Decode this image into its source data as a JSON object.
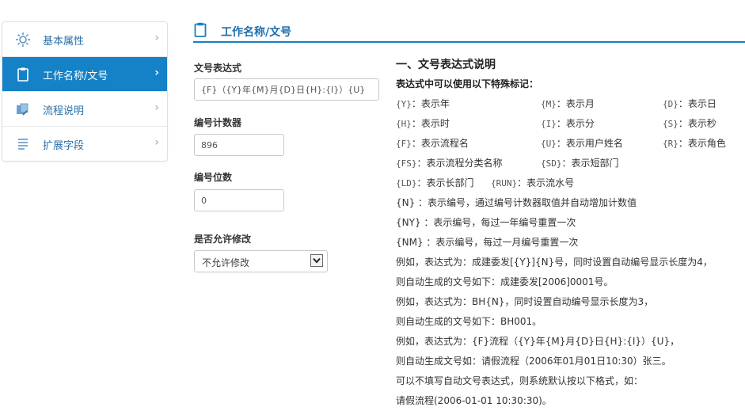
{
  "sidebar": {
    "items": [
      {
        "label": "基本属性",
        "icon": "gear-icon",
        "active": false
      },
      {
        "label": "工作名称/文号",
        "icon": "clipboard-icon",
        "active": true
      },
      {
        "label": "流程说明",
        "icon": "flow-icon",
        "active": false
      },
      {
        "label": "扩展字段",
        "icon": "list-icon",
        "active": false
      }
    ]
  },
  "header": {
    "title": "工作名称/文号",
    "icon": "clipboard-icon",
    "accent": "#1581c6"
  },
  "form": {
    "expr_label": "文号表达式",
    "expr_value": "{F}（{Y}年{M}月{D}日{H}:{I}）{U}",
    "counter_label": "编号计数器",
    "counter_value": "896",
    "digits_label": "编号位数",
    "digits_value": "0",
    "editable_label": "是否允许修改",
    "editable_value": "不允许修改"
  },
  "help": {
    "title": "一、文号表达式说明",
    "subtitle": "表达式中可以使用以下特殊标记：",
    "tokens": [
      {
        "code": "{Y}",
        "desc": "：表示年"
      },
      {
        "code": "{M}",
        "desc": "：表示月"
      },
      {
        "code": "{D}",
        "desc": "：表示日"
      },
      {
        "code": "{H}",
        "desc": "：表示时"
      },
      {
        "code": "{I}",
        "desc": "：表示分"
      },
      {
        "code": "{S}",
        "desc": "：表示秒"
      },
      {
        "code": "{F}",
        "desc": "：表示流程名"
      },
      {
        "code": "{U}",
        "desc": "：表示用户姓名"
      },
      {
        "code": "{R}",
        "desc": "：表示角色"
      },
      {
        "code": "{FS}",
        "desc": "：表示流程分类名称"
      },
      {
        "code": "{SD}",
        "desc": "：表示短部门"
      },
      {
        "code": "{LD}",
        "desc": "：表示长部门"
      },
      {
        "code": "{RUN}",
        "desc": "：表示流水号"
      }
    ],
    "lines": [
      "{N} ：表示编号，通过编号计数器取值并自动增加计数值",
      "{NY} ：表示编号，每过一年编号重置一次",
      "{NM} ：表示编号，每过一月编号重置一次",
      "例如，表达式为：成建委发[{Y}]{N}号，同时设置自动编号显示长度为4，",
      "则自动生成的文号如下：成建委发[2006]0001号。",
      "例如，表达式为：BH{N}，同时设置自动编号显示长度为3，",
      "则自动生成的文号如下：BH001。",
      "例如，表达式为：{F}流程（{Y}年{M}月{D}日{H}:{I}）{U}，",
      "则自动生成文号如：请假流程（2006年01月01日10:30）张三。",
      "可以不填写自动文号表达式，则系统默认按以下格式，如：",
      "请假流程(2006-01-01 10:30:30)。"
    ]
  }
}
